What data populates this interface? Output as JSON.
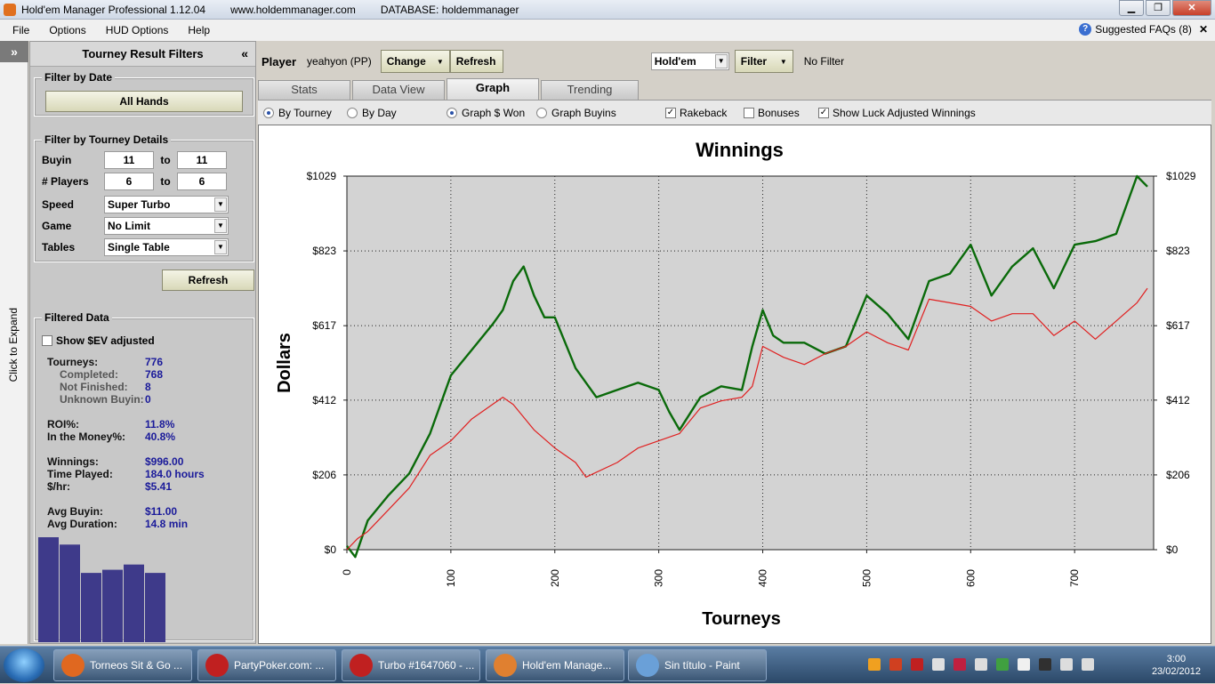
{
  "window": {
    "title": "Hold'em Manager Professional 1.12.04",
    "url": "www.holdemmanager.com",
    "database": "DATABASE: holdemmanager"
  },
  "menu": [
    "File",
    "Options",
    "HUD Options",
    "Help"
  ],
  "faq": "Suggested FAQs (8)",
  "expand_strip": {
    "chevrons": "»",
    "label": "Click to Expand"
  },
  "left_panel": {
    "title": "Tourney Result Filters",
    "collapse": "«",
    "filter_by_date": {
      "title": "Filter by Date",
      "button": "All Hands"
    },
    "filter_details": {
      "title": "Filter by Tourney Details",
      "buyin_label": "Buyin",
      "buyin_from": "11",
      "buyin_to": "11",
      "to": "to",
      "players_label": "# Players",
      "players_from": "6",
      "players_to": "6",
      "speed_label": "Speed",
      "speed_value": "Super Turbo",
      "game_label": "Game",
      "game_value": "No Limit",
      "tables_label": "Tables",
      "tables_value": "Single Table"
    },
    "refresh": "Refresh",
    "filtered_data": {
      "title": "Filtered Data",
      "show_ev": "Show $EV adjusted",
      "rows": [
        {
          "k": "Tourneys:",
          "v": "776",
          "sub": false
        },
        {
          "k": "Completed:",
          "v": "768",
          "sub": true
        },
        {
          "k": "Not Finished:",
          "v": "8",
          "sub": true
        },
        {
          "k": "Unknown Buyin:",
          "v": "0",
          "sub": true
        },
        {
          "k": "ROI%:",
          "v": "11.8%",
          "sub": false
        },
        {
          "k": "In the Money%:",
          "v": "40.8%",
          "sub": false
        },
        {
          "k": "Winnings:",
          "v": "$996.00",
          "sub": false
        },
        {
          "k": "Time Played:",
          "v": "184.0 hours",
          "sub": false
        },
        {
          "k": "$/hr:",
          "v": "$5.41",
          "sub": false
        },
        {
          "k": "Avg Buyin:",
          "v": "$11.00",
          "sub": false
        },
        {
          "k": "Avg Duration:",
          "v": "14.8 min",
          "sub": false
        }
      ],
      "minibars": [
        1.0,
        0.93,
        0.66,
        0.69,
        0.74,
        0.66
      ]
    }
  },
  "toolbar": {
    "player_label": "Player",
    "player_name": "yeahyon (PP)",
    "change": "Change",
    "refresh": "Refresh",
    "game": "Hold'em",
    "filter": "Filter",
    "filter_status": "No Filter"
  },
  "tabs": [
    "Stats",
    "Data View",
    "Graph",
    "Trending"
  ],
  "options": {
    "by_tourney": "By Tourney",
    "by_day": "By Day",
    "graph_won": "Graph $ Won",
    "graph_buyins": "Graph Buyins",
    "rakeback": "Rakeback",
    "bonuses": "Bonuses",
    "luck": "Show Luck Adjusted Winnings"
  },
  "chart_data": {
    "type": "line",
    "title": "Winnings",
    "xlabel": "Tourneys",
    "ylabel": "Dollars",
    "xlim": [
      0,
      776
    ],
    "ylim": [
      0,
      1029
    ],
    "x_ticks": [
      0,
      100,
      200,
      300,
      400,
      500,
      600,
      700
    ],
    "y_ticks": [
      0,
      206,
      412,
      617,
      823,
      1029
    ],
    "y_tick_labels": [
      "$0",
      "$206",
      "$412",
      "$617",
      "$823",
      "$1029"
    ],
    "grid": true,
    "series": [
      {
        "color": "#0a6a0a",
        "x": [
          0,
          8,
          20,
          40,
          60,
          80,
          100,
          120,
          140,
          150,
          160,
          170,
          180,
          190,
          200,
          220,
          240,
          260,
          280,
          300,
          310,
          320,
          340,
          360,
          380,
          390,
          400,
          410,
          420,
          440,
          460,
          480,
          500,
          520,
          540,
          560,
          580,
          600,
          620,
          640,
          660,
          680,
          700,
          720,
          740,
          760,
          770
        ],
        "values": [
          10,
          -20,
          80,
          150,
          210,
          320,
          480,
          550,
          620,
          660,
          740,
          780,
          700,
          640,
          640,
          500,
          420,
          440,
          460,
          440,
          380,
          330,
          420,
          450,
          440,
          560,
          660,
          590,
          570,
          570,
          540,
          560,
          700,
          650,
          580,
          740,
          760,
          840,
          700,
          780,
          830,
          720,
          840,
          850,
          870,
          1029,
          1000
        ]
      },
      {
        "color": "#e02020",
        "x": [
          0,
          10,
          20,
          40,
          60,
          80,
          100,
          120,
          140,
          150,
          160,
          180,
          200,
          220,
          230,
          260,
          280,
          300,
          320,
          340,
          360,
          380,
          390,
          400,
          420,
          440,
          460,
          480,
          500,
          520,
          540,
          560,
          580,
          600,
          620,
          640,
          660,
          680,
          700,
          720,
          740,
          760,
          770
        ],
        "values": [
          0,
          30,
          50,
          110,
          170,
          260,
          300,
          360,
          400,
          420,
          400,
          330,
          280,
          240,
          200,
          240,
          280,
          300,
          320,
          390,
          410,
          420,
          450,
          560,
          530,
          510,
          540,
          560,
          600,
          570,
          550,
          690,
          680,
          670,
          630,
          650,
          650,
          590,
          630,
          580,
          630,
          680,
          720
        ]
      }
    ]
  },
  "taskbar": {
    "items": [
      {
        "label": "Torneos Sit & Go ...",
        "color": "#e06820"
      },
      {
        "label": "PartyPoker.com: ...",
        "color": "#c02020"
      },
      {
        "label": "Turbo #1647060 - ...",
        "color": "#c02020"
      },
      {
        "label": "Hold'em Manage...",
        "color": "#e08030"
      },
      {
        "label": "Sin título - Paint",
        "color": "#6aa0d8"
      }
    ],
    "time": "3:00",
    "date": "23/02/2012"
  }
}
